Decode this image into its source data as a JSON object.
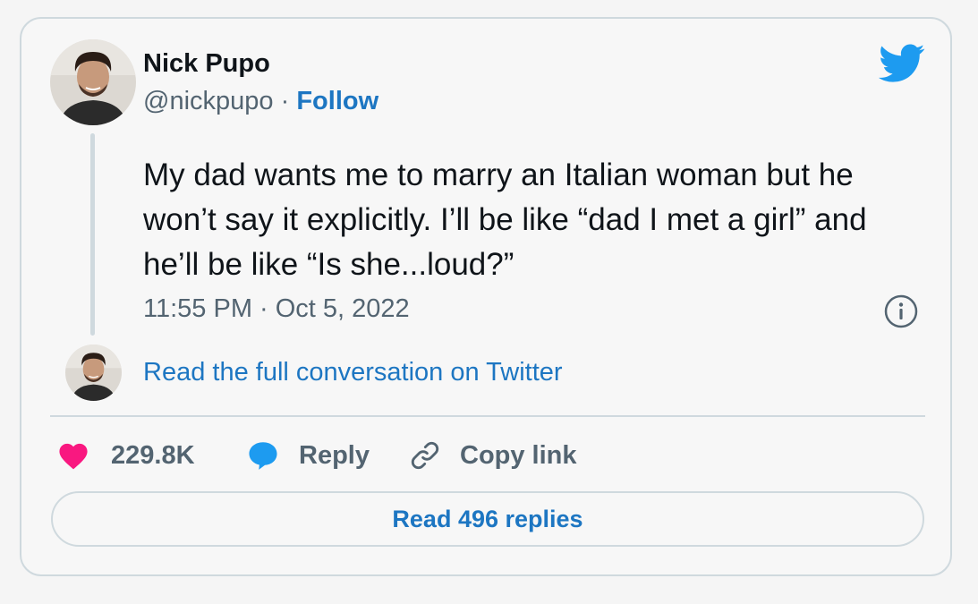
{
  "tweet": {
    "author_name": "Nick Pupo",
    "handle": "@nickpupo",
    "separator": "·",
    "follow_label": "Follow",
    "text": "My dad wants me to marry an Italian woman but he won’t say it explicitly. I’ll be like “dad I met a girl” and he’ll be like “Is she...loud?”",
    "timestamp": "11:55 PM · Oct 5, 2022",
    "full_conversation_label": "Read the full conversation on Twitter"
  },
  "actions": {
    "likes_count": "229.8K",
    "reply_label": "Reply",
    "copy_link_label": "Copy link",
    "read_replies_label": "Read 496 replies"
  },
  "icons": {
    "brand": "twitter-bird-icon",
    "info": "info-icon",
    "like": "heart-icon",
    "reply": "speech-bubble-icon",
    "copy": "link-icon"
  },
  "colors": {
    "link_blue": "#1d76c2",
    "twitter_blue": "#1d9bf0",
    "heart_pink": "#f91880",
    "text_dark": "#0f1419",
    "text_muted": "#536471",
    "border": "#cfd9de"
  }
}
